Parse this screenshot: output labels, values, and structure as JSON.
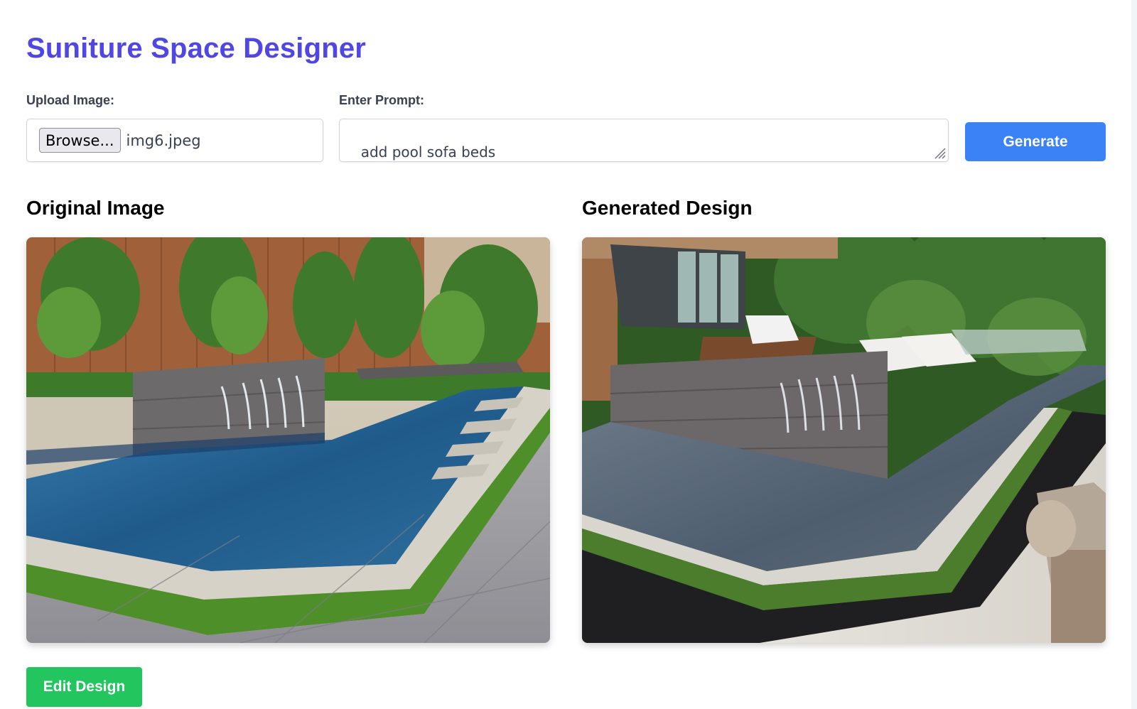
{
  "app": {
    "title": "Suniture Space Designer"
  },
  "upload": {
    "label": "Upload Image:",
    "browse_label": "Browse...",
    "file_name": "img6.jpeg"
  },
  "prompt": {
    "label": "Enter Prompt:",
    "value": "add pool sofa beds\n and stylish umbrellas"
  },
  "actions": {
    "generate_label": "Generate",
    "edit_label": "Edit Design"
  },
  "sections": {
    "original_title": "Original Image",
    "generated_title": "Generated Design"
  },
  "colors": {
    "title": "#4f46e5",
    "generate": "#3b82f6",
    "edit": "#22c55e"
  },
  "icons": {
    "resize": "resize-grip-icon"
  }
}
